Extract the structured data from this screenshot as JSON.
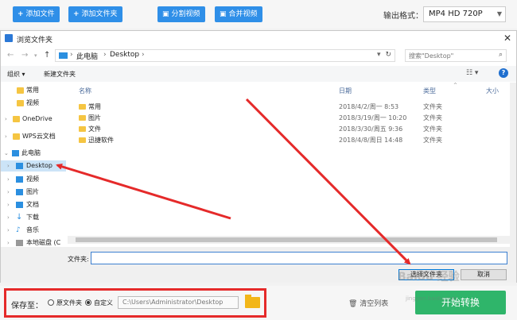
{
  "toolbar": {
    "add_file": "添加文件",
    "add_folder": "添加文件夹",
    "split_video": "分割视频",
    "merge_video": "合并视频",
    "format_label": "输出格式：",
    "format_value": "MP4  HD 720P"
  },
  "dialog": {
    "title": "浏览文件夹",
    "close": "✕",
    "path": [
      "此电脑",
      "Desktop"
    ],
    "search_placeholder": "搜索\"Desktop\"",
    "organize": "组织 ▾",
    "new_folder": "新建文件夹",
    "columns": {
      "name": "名称",
      "date": "日期",
      "type": "类型",
      "size": "大小"
    },
    "tree": [
      {
        "label": "常用",
        "icon": "folder-yellow"
      },
      {
        "label": "视频",
        "icon": "folder-yellow"
      },
      {
        "label": "OneDrive",
        "icon": "folder-yellow"
      },
      {
        "label": "WPS云文档",
        "icon": "folder-yellow"
      },
      {
        "label": "此电脑",
        "icon": "computer"
      },
      {
        "label": "Desktop",
        "icon": "desktop"
      },
      {
        "label": "视频",
        "icon": "video"
      },
      {
        "label": "图片",
        "icon": "pictures"
      },
      {
        "label": "文档",
        "icon": "documents"
      },
      {
        "label": "下载",
        "icon": "download"
      },
      {
        "label": "音乐",
        "icon": "music"
      },
      {
        "label": "本地磁盘 (C",
        "icon": "disk"
      }
    ],
    "files": [
      {
        "name": "常用",
        "date": "2018/4/2/周一 8:53",
        "type": "文件夹"
      },
      {
        "name": "图片",
        "date": "2018/3/19/周一 10:20",
        "type": "文件夹"
      },
      {
        "name": "文件",
        "date": "2018/3/30/周五 9:36",
        "type": "文件夹"
      },
      {
        "name": "迅捷软件",
        "date": "2018/4/8/周日 14:48",
        "type": "文件夹"
      }
    ],
    "folder_label": "文件夹:",
    "folder_value": "",
    "select_button": "选择文件夹",
    "cancel_button": "取消"
  },
  "appbar": {
    "save_to": "保存至：",
    "option_original": "原文件夹",
    "option_custom": "自定义",
    "custom_path": "C:\\Users\\Administrator\\Desktop",
    "clear_list": "清空列表",
    "start": "开始转换",
    "watermark": "Baidu 经验",
    "watermark_sub": "jingyan.baidu.com"
  },
  "colors": {
    "accent": "#2f8fe8",
    "start": "#2fb56a",
    "annotation": "#e52a2a"
  }
}
